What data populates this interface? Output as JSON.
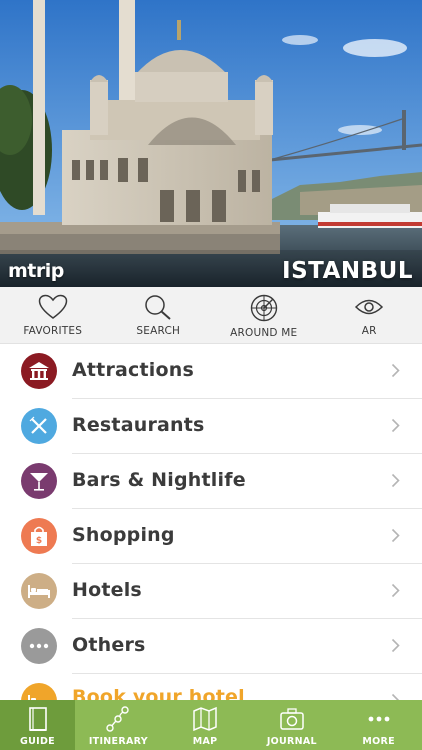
{
  "hero": {
    "brand": "mtrip",
    "city": "ISTANBUL"
  },
  "quick_actions": [
    {
      "label": "FAVORITES",
      "icon": "heart-icon"
    },
    {
      "label": "SEARCH",
      "icon": "magnifier-icon"
    },
    {
      "label": "AROUND ME",
      "icon": "radar-icon"
    },
    {
      "label": "AR",
      "icon": "eye-icon"
    }
  ],
  "categories": [
    {
      "label": "Attractions",
      "icon": "monument-icon",
      "color": "#8b1a22"
    },
    {
      "label": "Restaurants",
      "icon": "fork-knife-icon",
      "color": "#4fa9e0"
    },
    {
      "label": "Bars & Nightlife",
      "icon": "cocktail-icon",
      "color": "#7a3b6f"
    },
    {
      "label": "Shopping",
      "icon": "shopping-bag-icon",
      "color": "#ee7a52"
    },
    {
      "label": "Hotels",
      "icon": "bed-icon",
      "color": "#cdae86"
    },
    {
      "label": "Others",
      "icon": "ellipsis-icon",
      "color": "#9a9a9a"
    },
    {
      "label": "Book your hotel",
      "icon": "bed-icon",
      "color": "#f0a52a"
    }
  ],
  "tabs": [
    {
      "label": "GUIDE",
      "icon": "book-icon",
      "active": true
    },
    {
      "label": "ITINERARY",
      "icon": "route-icon",
      "active": false
    },
    {
      "label": "MAP",
      "icon": "map-icon",
      "active": false
    },
    {
      "label": "JOURNAL",
      "icon": "camera-icon",
      "active": false
    },
    {
      "label": "MORE",
      "icon": "more-dots-icon",
      "active": false
    }
  ],
  "colors": {
    "tabbar": "#8dba55",
    "tab_active": "#6e9c3c",
    "book_accent": "#f0a52a"
  }
}
